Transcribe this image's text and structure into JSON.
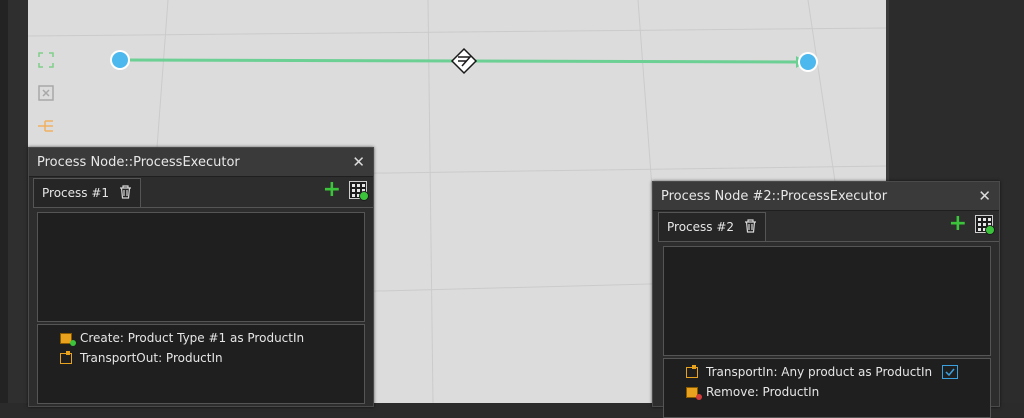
{
  "canvas": {
    "grid_color": "#cfcfcf",
    "link_color": "#6ccf93",
    "node_color": "#4cb8ee"
  },
  "tools": [
    {
      "icon": "expand-icon",
      "color": "#7fcf8a"
    },
    {
      "icon": "collapse-icon",
      "color": "#a8a8a8"
    },
    {
      "icon": "branch-icon",
      "color": "#f0b060"
    }
  ],
  "panel1": {
    "title": "Process Node::ProcessExecutor",
    "tab_label": "Process #1",
    "items": [
      {
        "text": "Create: Product Type #1 as ProductIn",
        "icon": "create-box-icon"
      },
      {
        "text": "TransportOut: ProductIn",
        "icon": "transport-out-icon"
      }
    ]
  },
  "panel2": {
    "title": "Process Node #2::ProcessExecutor",
    "tab_label": "Process #2",
    "items": [
      {
        "text": "TransportIn: Any product as ProductIn",
        "icon": "transport-in-icon"
      },
      {
        "text": "Remove: ProductIn",
        "icon": "remove-box-icon"
      }
    ]
  }
}
